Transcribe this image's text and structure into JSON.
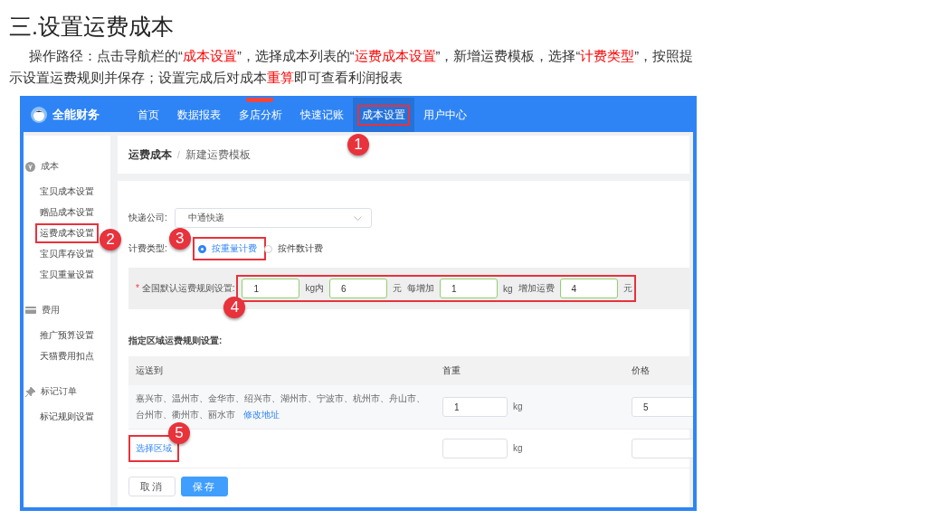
{
  "heading": "三.设置运费成本",
  "intro": [
    {
      "text": "操作路径：点击导航栏的“",
      "highlight": false
    },
    {
      "text": "成本设置",
      "highlight": true
    },
    {
      "text": "”，选择成本列表的“",
      "highlight": false
    },
    {
      "text": "运费成本设置",
      "highlight": true
    },
    {
      "text": "”，新增运费模板，选择“",
      "highlight": false
    },
    {
      "text": "计费类型",
      "highlight": true
    },
    {
      "text": "”，按照提示设置运费规则并保存；设置完成后对成本",
      "highlight": false
    },
    {
      "text": "重算",
      "highlight": true
    },
    {
      "text": "即可查看利润报表",
      "highlight": false
    }
  ],
  "app": {
    "logo": "全能财务",
    "nav": [
      {
        "label": "首页",
        "selected": false,
        "badge": false
      },
      {
        "label": "数据报表",
        "selected": false,
        "badge": false
      },
      {
        "label": "多店分析",
        "selected": false,
        "badge": true
      },
      {
        "label": "快速记账",
        "selected": false,
        "badge": false
      },
      {
        "label": "成本设置",
        "selected": true,
        "badge": false,
        "callout": "1"
      },
      {
        "label": "用户中心",
        "selected": false,
        "badge": false
      }
    ],
    "sidebar": [
      {
        "title": "成本",
        "items": [
          {
            "label": "宝贝成本设置"
          },
          {
            "label": "赠品成本设置"
          },
          {
            "label": "运费成本设置",
            "callout": "2"
          },
          {
            "label": "宝贝库存设置"
          },
          {
            "label": "宝贝重量设置"
          }
        ]
      },
      {
        "title": "费用",
        "items": [
          {
            "label": "推广预算设置"
          },
          {
            "label": "天猫费用扣点"
          }
        ]
      },
      {
        "title": "标记订单",
        "items": [
          {
            "label": "标记规则设置"
          }
        ]
      }
    ],
    "breadcrumb": [
      "运费成本",
      "新建运费模板"
    ],
    "breadcrumb_separator": "/",
    "courier": {
      "label": "快递公司:",
      "value": "中通快递"
    },
    "billing": {
      "label": "计费类型:",
      "options": [
        {
          "label": "按重量计费",
          "selected": true,
          "callout": "3"
        },
        {
          "label": "按件数计费",
          "selected": false
        }
      ]
    },
    "default_rule": {
      "label": "全国默认运费规则设置:",
      "required": true,
      "required_mark": "*",
      "callout": "4",
      "parts": [
        {
          "kind": "input",
          "value": "1"
        },
        {
          "kind": "text",
          "text": "kg内"
        },
        {
          "kind": "input",
          "value": "6"
        },
        {
          "kind": "text",
          "text": "元"
        },
        {
          "kind": "text",
          "text": "每增加"
        },
        {
          "kind": "input",
          "value": "1"
        },
        {
          "kind": "text",
          "text": "kg"
        },
        {
          "kind": "text",
          "text": "增加运费"
        },
        {
          "kind": "input",
          "value": "4"
        },
        {
          "kind": "text",
          "text": "元"
        }
      ]
    },
    "region_title": "指定区域运费规则设置:",
    "table": {
      "columns": [
        "运送到",
        "首重",
        "价格"
      ],
      "rows": [
        {
          "regions": "嘉兴市、温州市、金华市、绍兴市、湖州市、宁波市、杭州市、舟山市、台州市、衢州市、丽水市",
          "link": "修改地址",
          "weight": "1",
          "weight_unit": "kg",
          "price": "5"
        },
        {
          "link": "选择区域",
          "weight_unit": "kg",
          "callout": "5"
        }
      ]
    },
    "buttons": [
      {
        "label": "取消",
        "kind": "default"
      },
      {
        "label": "保存",
        "kind": "primary"
      }
    ]
  }
}
